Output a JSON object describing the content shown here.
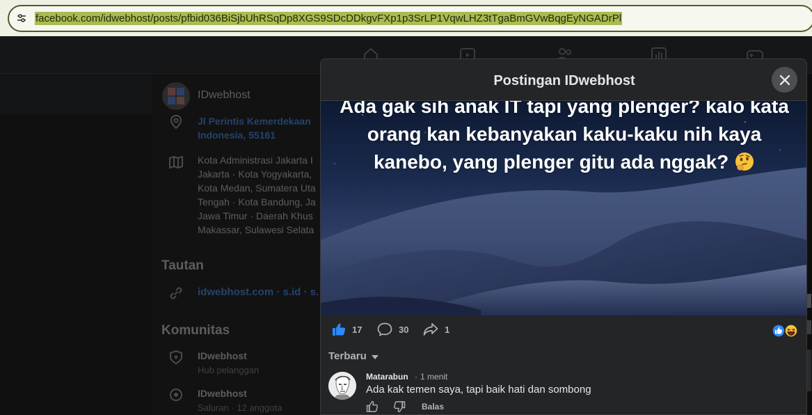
{
  "browser": {
    "url": "facebook.com/idwebhost/posts/pfbid036BiSjbUhRSqDp8XGS9SDcDDkgvFXp1p3SrLP1VqwLHZ3tTgaBmGVwBqgEyNGADrPl"
  },
  "background_page": {
    "page_name": "IDwebhost",
    "address": "Jl Perintis Kemerdekaan\nIndonesia, 55161",
    "areas": "Kota Administrasi Jakarta I\nJakarta · Kota Yogyakarta,\nKota Medan, Sumatera Uta\nTengah · Kota Bandung, Ja\nJawa Timur · Daerah Khus\nMakassar, Sulawesi Selata",
    "links_heading": "Tautan",
    "links": "idwebhost.com · s.id · s.",
    "community_heading": "Komunitas",
    "community_items": [
      {
        "name": "IDwebhost",
        "sub": "Hub pelanggan"
      },
      {
        "name": "IDwebhost",
        "sub": "Saluran · 12 anggota"
      }
    ]
  },
  "modal": {
    "title": "Postingan IDwebhost",
    "post_text": "Ada gak sih anak IT tapi yang plenger? kalo kata orang kan kebanyakan kaku-kaku nih kaya kanebo, yang plenger gitu ada nggak?",
    "likes": "17",
    "comments": "30",
    "shares": "1",
    "sort_label": "Terbaru",
    "comment": {
      "author": "Matarabun",
      "separator": "·",
      "time": "1 menit",
      "text": "Ada kak temen saya, tapi baik hati dan sombong",
      "reply_label": "Balas"
    }
  },
  "colors": {
    "accent_blue": "#2d88ff",
    "modal_bg": "#242526",
    "url_highlight": "#a9bb52"
  },
  "icons": [
    "settings-sliders-icon",
    "close-icon",
    "like-icon",
    "comment-icon",
    "share-icon",
    "reaction-like-icon",
    "reaction-haha-icon",
    "thumb-up-outline-icon",
    "thumb-down-outline-icon",
    "location-pin-icon",
    "map-icon",
    "link-icon",
    "shield-heart-icon",
    "broadcast-icon",
    "home-icon",
    "video-icon",
    "friends-icon",
    "stats-icon",
    "gaming-icon",
    "thinking-face-emoji"
  ]
}
